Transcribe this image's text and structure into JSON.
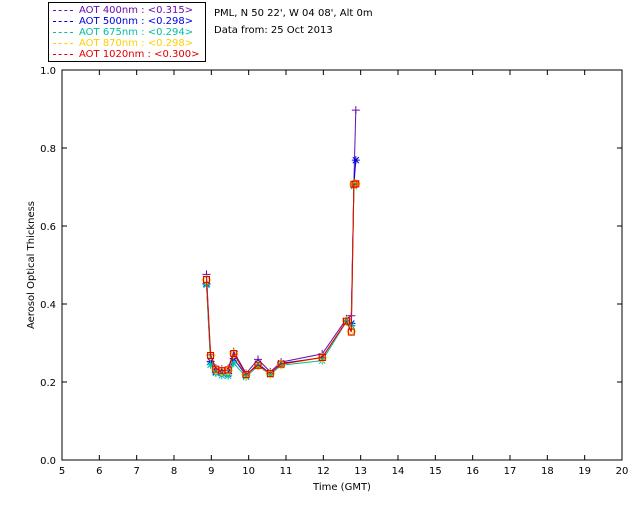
{
  "header": {
    "site": "PML, N 50 22', W 04 08', Alt 0m",
    "date_line": "Data from: 25 Oct 2013"
  },
  "legend": [
    {
      "label": "AOT  400nm : <0.315>",
      "color": "#6a0dad"
    },
    {
      "label": "AOT  500nm : <0.298>",
      "color": "#0000e0"
    },
    {
      "label": "AOT  675nm : <0.294>",
      "color": "#00c0a0"
    },
    {
      "label": "AOT  870nm : <0.298>",
      "color": "#ffd000"
    },
    {
      "label": "AOT 1020nm : <0.300>",
      "color": "#e00000"
    }
  ],
  "chart_data": {
    "type": "line",
    "xlabel": "Time (GMT)",
    "ylabel": "Aerosol Optical Thickness",
    "xlim": [
      5,
      20
    ],
    "ylim": [
      0.0,
      1.0
    ],
    "xticks": [
      "5",
      "6",
      "7",
      "8",
      "9",
      "10",
      "11",
      "12",
      "13",
      "14",
      "15",
      "16",
      "17",
      "18",
      "19",
      "20"
    ],
    "yticks": [
      "0.0",
      "0.2",
      "0.4",
      "0.6",
      "0.8",
      "1.0"
    ],
    "grid": false,
    "legend_position": "top-left outside",
    "series": [
      {
        "name": "AOT  400nm",
        "marker": "plus",
        "color": "#6a0dad",
        "x": [
          8.87,
          8.98,
          9.12,
          9.28,
          9.45,
          9.6,
          9.93,
          10.25,
          10.58,
          10.87,
          11.97,
          12.62,
          12.75,
          12.82,
          12.87
        ],
        "y": [
          0.476,
          0.27,
          0.236,
          0.233,
          0.235,
          0.278,
          0.222,
          0.258,
          0.226,
          0.251,
          0.272,
          0.362,
          0.37,
          0.71,
          0.897
        ]
      },
      {
        "name": "AOT  500nm",
        "marker": "star",
        "color": "#0000e0",
        "x": [
          8.87,
          8.98,
          9.12,
          9.28,
          9.45,
          9.6,
          9.93,
          10.25,
          10.58,
          10.87,
          11.97,
          12.62,
          12.75,
          12.82,
          12.87
        ],
        "y": [
          0.452,
          0.253,
          0.226,
          0.223,
          0.221,
          0.26,
          0.217,
          0.247,
          0.221,
          0.248,
          0.262,
          0.356,
          0.35,
          0.706,
          0.769
        ]
      },
      {
        "name": "AOT  675nm",
        "marker": "star",
        "color": "#00c0a0",
        "x": [
          8.87,
          8.98,
          9.12,
          9.28,
          9.45,
          9.6,
          9.93,
          10.25,
          10.58,
          10.87,
          11.97,
          12.62,
          12.75,
          12.82,
          12.87
        ],
        "y": [
          0.449,
          0.244,
          0.223,
          0.217,
          0.216,
          0.248,
          0.213,
          0.241,
          0.219,
          0.243,
          0.255,
          0.355,
          0.345,
          0.702,
          0.71
        ]
      },
      {
        "name": "AOT  870nm",
        "marker": "diamond",
        "color": "#ffd000",
        "x": [
          8.87,
          8.98,
          9.12,
          9.28,
          9.45,
          9.6,
          9.93,
          10.25,
          10.58,
          10.87,
          11.97,
          12.62,
          12.75,
          12.82,
          12.87
        ],
        "y": [
          0.462,
          0.268,
          0.232,
          0.228,
          0.23,
          0.272,
          0.218,
          0.242,
          0.221,
          0.245,
          0.262,
          0.356,
          0.33,
          0.707,
          0.708
        ]
      },
      {
        "name": "AOT 1020nm",
        "marker": "square",
        "color": "#e00000",
        "x": [
          8.87,
          8.98,
          9.12,
          9.28,
          9.45,
          9.6,
          9.93,
          10.25,
          10.58,
          10.87,
          11.97,
          12.62,
          12.75,
          12.82,
          12.87
        ],
        "y": [
          0.463,
          0.268,
          0.233,
          0.229,
          0.231,
          0.273,
          0.219,
          0.243,
          0.222,
          0.246,
          0.263,
          0.356,
          0.328,
          0.707,
          0.708
        ]
      }
    ]
  }
}
